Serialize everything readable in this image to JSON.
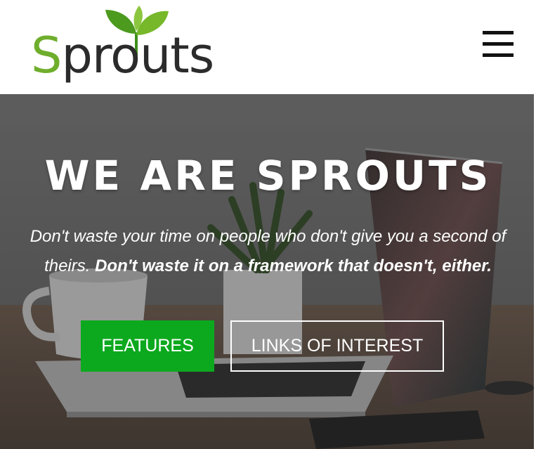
{
  "header": {
    "logo_text_first": "S",
    "logo_text_rest": "prouts",
    "menu_icon": "hamburger-menu-icon"
  },
  "hero": {
    "title": "WE ARE SPROUTS",
    "subtitle_regular": "Don't waste your time on people who don't give you a second of theirs.",
    "subtitle_bold": "Don't waste it on a framework that doesn't, either.",
    "features_label": "FEATURES",
    "links_label": "LINKS OF INTEREST"
  },
  "colors": {
    "brand_green": "#0ca91e",
    "logo_green": "#6fae2c",
    "header_bg": "#ffffff"
  }
}
